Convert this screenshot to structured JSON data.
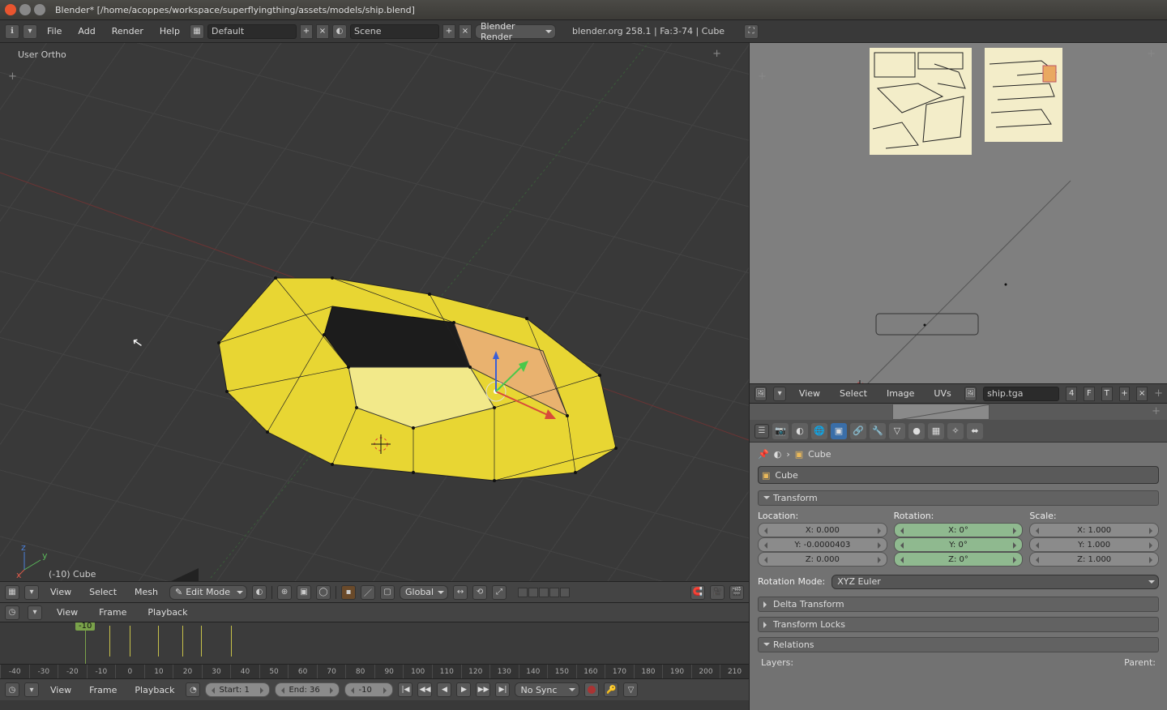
{
  "window": {
    "title": "Blender* [/home/acoppes/workspace/superflyingthing/assets/models/ship.blend]"
  },
  "topbar": {
    "menus": [
      "File",
      "Add",
      "Render",
      "Help"
    ],
    "layout": "Default",
    "scene": "Scene",
    "engine": "Blender Render",
    "status": "blender.org 258.1 | Fa:3-74 | Cube"
  },
  "viewport": {
    "projection": "User Ortho",
    "object_label": "(-10) Cube",
    "header": {
      "menus": [
        "View",
        "Select",
        "Mesh"
      ],
      "mode": "Edit Mode",
      "orientation": "Global"
    }
  },
  "uv_editor": {
    "menus": [
      "View",
      "Select",
      "Image",
      "UVs"
    ],
    "image_name": "ship.tga",
    "layer": "4",
    "flags": [
      "F",
      "T"
    ]
  },
  "properties": {
    "breadcrumb": "Cube",
    "name": "Cube",
    "panels": {
      "transform": "Transform",
      "delta": "Delta Transform",
      "locks": "Transform Locks",
      "relations": "Relations"
    },
    "transform": {
      "loc_label": "Location:",
      "rot_label": "Rotation:",
      "scale_label": "Scale:",
      "loc": {
        "x": "X: 0.000",
        "y": "Y: -0.0000403",
        "z": "Z: 0.000"
      },
      "rot": {
        "x": "X: 0°",
        "y": "Y: 0°",
        "z": "Z: 0°"
      },
      "scale": {
        "x": "X: 1.000",
        "y": "Y: 1.000",
        "z": "Z: 1.000"
      },
      "mode_label": "Rotation Mode:",
      "mode": "XYZ Euler",
      "layers": "Layers:",
      "parent": "Parent:"
    }
  },
  "timeline": {
    "menus": [
      "View",
      "Frame",
      "Playback"
    ],
    "start": "Start: 1",
    "end": "End: 36",
    "current": "-10",
    "sync": "No Sync",
    "ticks": [
      "-40",
      "-30",
      "-20",
      "-10",
      "0",
      "10",
      "20",
      "30",
      "40",
      "50",
      "60",
      "70",
      "80",
      "90",
      "100",
      "110",
      "120",
      "130",
      "140",
      "150",
      "160",
      "170",
      "180",
      "190",
      "200",
      "210"
    ]
  }
}
